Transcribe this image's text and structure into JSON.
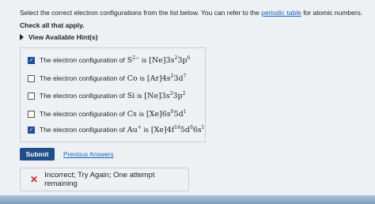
{
  "question": {
    "text": "Select the correct electron configurations from the list below. You can refer to the",
    "link": "periodic table",
    "suffix": "for atomic numbers."
  },
  "check_all": "Check all that apply.",
  "hints_label": "View Available Hint(s)",
  "options": [
    {
      "prefix": "The electron configuration of",
      "species": "S",
      "charge": "2−",
      "is": "is",
      "config": "[Ne]3s",
      "e1": "2",
      "mid": "3p",
      "e2": "6",
      "tail": "",
      "e3": "",
      "checked": true
    },
    {
      "prefix": "The electron configuration of",
      "species": "Co",
      "charge": "",
      "is": "is",
      "config": "[Ar]4s",
      "e1": "2",
      "mid": "3d",
      "e2": "7",
      "tail": "",
      "e3": "",
      "checked": false
    },
    {
      "prefix": "The electron configuration of",
      "species": "Si",
      "charge": "",
      "is": "is",
      "config": "[Ne]3s",
      "e1": "2",
      "mid": "3p",
      "e2": "2",
      "tail": "",
      "e3": "",
      "checked": false
    },
    {
      "prefix": "The electron configuration of",
      "species": "Cs",
      "charge": "",
      "is": "is",
      "config": "[Xe]6s",
      "e1": "0",
      "mid": "5d",
      "e2": "1",
      "tail": "",
      "e3": "",
      "checked": false
    },
    {
      "prefix": "The electron configuration of",
      "species": "Au",
      "charge": "+",
      "is": "is",
      "config": "[Xe]4f",
      "e1": "14",
      "mid": "5d",
      "e2": "9",
      "tail": "6s",
      "e3": "1",
      "checked": true
    }
  ],
  "submit_label": "Submit",
  "previous_answers_label": "Previous Answers",
  "feedback": "Incorrect; Try Again; One attempt remaining",
  "colors": {
    "accent": "#1f4f88",
    "link": "#1565c0",
    "error": "#c62828"
  }
}
